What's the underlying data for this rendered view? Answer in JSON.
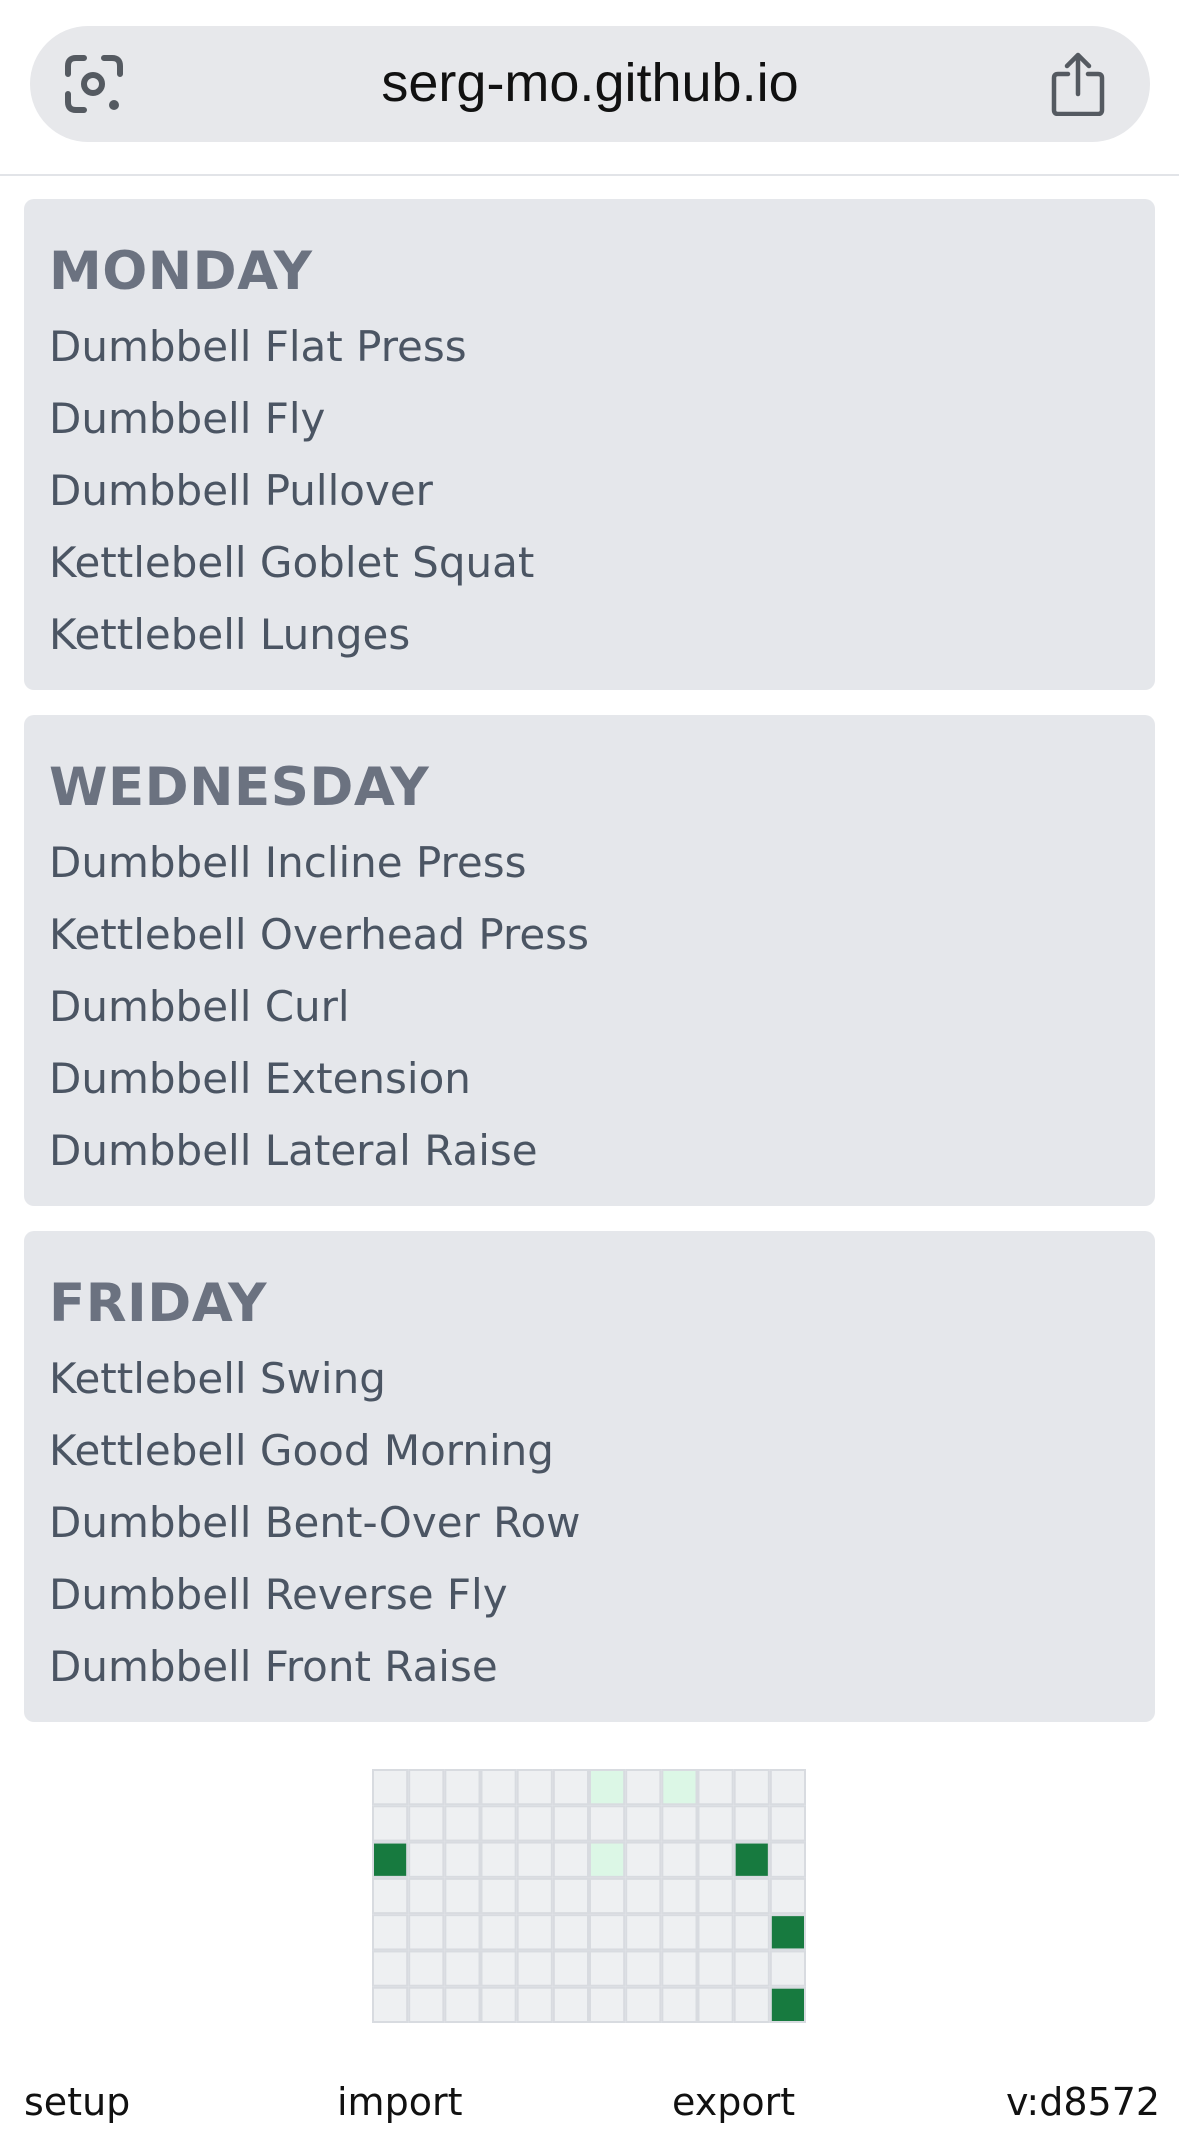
{
  "browser": {
    "url": "serg-mo.github.io"
  },
  "days": [
    {
      "title": "MONDAY",
      "exercises": [
        "Dumbbell Flat Press",
        "Dumbbell Fly",
        "Dumbbell Pullover",
        "Kettlebell Goblet Squat",
        "Kettlebell Lunges"
      ]
    },
    {
      "title": "WEDNESDAY",
      "exercises": [
        "Dumbbell Incline Press",
        "Kettlebell Overhead Press",
        "Dumbbell Curl",
        "Dumbbell Extension",
        "Dumbbell Lateral Raise"
      ]
    },
    {
      "title": "FRIDAY",
      "exercises": [
        "Kettlebell Swing",
        "Kettlebell Good Morning",
        "Dumbbell Bent-Over Row",
        "Dumbbell Reverse Fly",
        "Dumbbell Front Raise"
      ]
    }
  ],
  "activity_grid": {
    "columns": 12,
    "rows": 7,
    "colors": {
      "empty": "#eef0f2",
      "light": "#dcf7e6",
      "dark": "#177a3f",
      "border": "#d8dbe0"
    },
    "cells": [
      {
        "row": 0,
        "col": 6,
        "level": "light"
      },
      {
        "row": 0,
        "col": 8,
        "level": "light"
      },
      {
        "row": 2,
        "col": 0,
        "level": "dark"
      },
      {
        "row": 2,
        "col": 6,
        "level": "light"
      },
      {
        "row": 2,
        "col": 10,
        "level": "dark"
      },
      {
        "row": 4,
        "col": 11,
        "level": "dark"
      },
      {
        "row": 6,
        "col": 11,
        "level": "dark"
      }
    ]
  },
  "footer": {
    "setup": "setup",
    "import": "import",
    "export": "export",
    "version": "v:d8572"
  }
}
